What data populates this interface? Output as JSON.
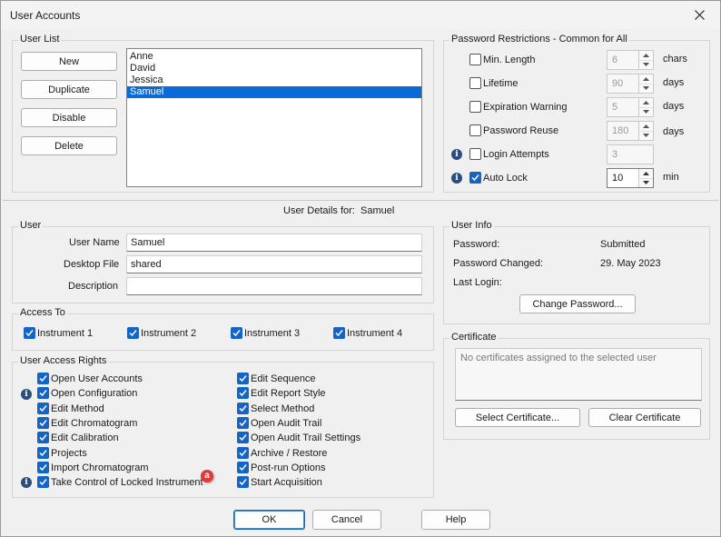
{
  "window": {
    "title": "User Accounts"
  },
  "user_list": {
    "legend": "User List",
    "buttons": {
      "new": "New",
      "duplicate": "Duplicate",
      "disable": "Disable",
      "delete": "Delete"
    },
    "users": [
      "Anne",
      "David",
      "Jessica",
      "Samuel"
    ],
    "selected": "Samuel"
  },
  "password_restrictions": {
    "legend": "Password Restrictions - Common for All",
    "rows": [
      {
        "label": "Min. Length",
        "checked": false,
        "value": "6",
        "unit": "chars",
        "info": false
      },
      {
        "label": "Lifetime",
        "checked": false,
        "value": "90",
        "unit": "days",
        "info": false
      },
      {
        "label": "Expiration Warning",
        "checked": false,
        "value": "5",
        "unit": "days",
        "info": false
      },
      {
        "label": "Password Reuse",
        "checked": false,
        "value": "180",
        "unit": "days",
        "info": false
      },
      {
        "label": "Login Attempts",
        "checked": false,
        "value": "3",
        "unit": "",
        "info": true
      },
      {
        "label": "Auto Lock",
        "checked": true,
        "value": "10",
        "unit": "min",
        "info": true
      }
    ]
  },
  "user_details": {
    "label": "User Details for:",
    "name": "Samuel"
  },
  "user": {
    "legend": "User",
    "user_name_label": "User Name",
    "user_name": "Samuel",
    "desktop_file_label": "Desktop File",
    "desktop_file": "shared",
    "description_label": "Description",
    "description": ""
  },
  "user_info": {
    "legend": "User Info",
    "password_label": "Password:",
    "password": "Submitted",
    "changed_label": "Password Changed:",
    "changed": "29. May 2023",
    "last_login_label": "Last Login:",
    "last_login": "",
    "change_button": "Change Password..."
  },
  "access_to": {
    "legend": "Access To",
    "instruments": [
      "Instrument 1",
      "Instrument 2",
      "Instrument 3",
      "Instrument 4"
    ]
  },
  "certificate": {
    "legend": "Certificate",
    "empty_text": "No certificates assigned to the selected user",
    "select_button": "Select Certificate...",
    "clear_button": "Clear Certificate"
  },
  "access_rights": {
    "legend": "User Access Rights",
    "left": [
      "Open User Accounts",
      "Open Configuration",
      "Edit Method",
      "Edit Chromatogram",
      "Edit Calibration",
      "Projects",
      "Import Chromatogram",
      "Take Control of Locked Instrument"
    ],
    "right": [
      "Edit Sequence",
      "Edit Report Style",
      "Select Method",
      "Open Audit Trail",
      "Open Audit Trail Settings",
      "Archive / Restore",
      "Post-run Options",
      "Start Acquisition"
    ],
    "annotation": "a"
  },
  "dialog_buttons": {
    "ok": "OK",
    "cancel": "Cancel",
    "help": "Help"
  },
  "colors": {
    "accent": "#1364c6",
    "selection": "#0a6ad8",
    "info_icon": "#2b4d7d",
    "annotation": "#e03a3a"
  }
}
